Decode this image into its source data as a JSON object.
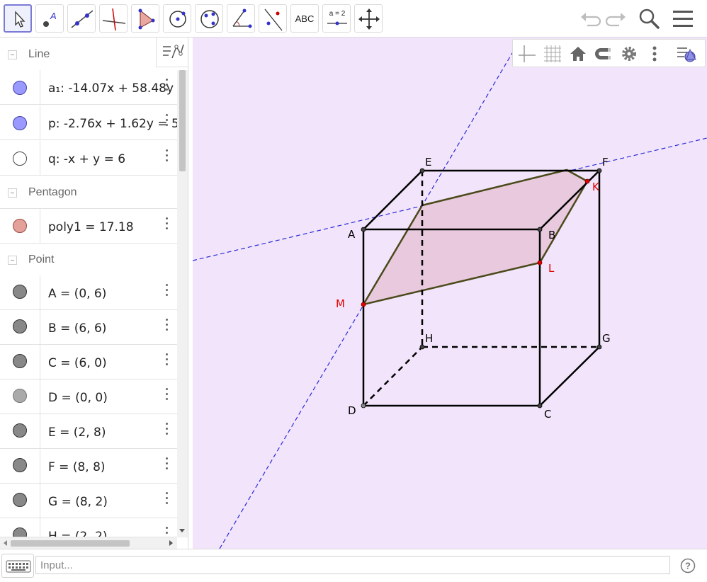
{
  "toolbar": {
    "text_tool_label": "ABC",
    "slider_tool_label": "a = 2",
    "icons": [
      "move-icon",
      "point-icon",
      "line-icon",
      "perpendicular-line-icon",
      "polygon-icon",
      "circle-icon",
      "ellipse-icon",
      "angle-icon",
      "reflect-icon",
      "text-icon",
      "slider-icon",
      "translate-icon",
      "undo-icon",
      "redo-icon",
      "search-icon",
      "menu-icon"
    ]
  },
  "algebra": {
    "groups": [
      {
        "title": "Line",
        "items": [
          {
            "text": "a₁: -14.07x + 58.48y",
            "color": "#9999ff"
          },
          {
            "text": "p: -2.76x + 1.62y = 5",
            "color": "#9999ff"
          },
          {
            "text": "q: -x + y = 6",
            "color": "#ffffff"
          }
        ]
      },
      {
        "title": "Pentagon",
        "items": [
          {
            "text": "poly1 = 17.18",
            "color": "#e3a19a"
          }
        ]
      },
      {
        "title": "Point",
        "items": [
          {
            "text": "A = (0, 6)",
            "color": "#888888"
          },
          {
            "text": "B = (6, 6)",
            "color": "#888888"
          },
          {
            "text": "C = (6, 0)",
            "color": "#888888"
          },
          {
            "text": "D = (0, 0)",
            "color": "#aaaaaa"
          },
          {
            "text": "E = (2, 8)",
            "color": "#888888"
          },
          {
            "text": "F = (8, 8)",
            "color": "#888888"
          },
          {
            "text": "G = (8, 2)",
            "color": "#888888"
          },
          {
            "text": "H = (2, 2)",
            "color": "#888888"
          }
        ]
      }
    ]
  },
  "graphics": {
    "background": "#f2e5fb",
    "cube_color": "#000000",
    "section_color": "#4a4a1a",
    "section_fill": "#e8c9dd",
    "line_color": "#2a2ad8",
    "labels": {
      "A": "A",
      "B": "B",
      "C": "C",
      "D": "D",
      "E": "E",
      "F": "F",
      "G": "G",
      "H": "H",
      "K": "K",
      "L": "L",
      "M": "M"
    },
    "highlight_color": "#e00000"
  },
  "inputbar": {
    "placeholder": "Input..."
  }
}
